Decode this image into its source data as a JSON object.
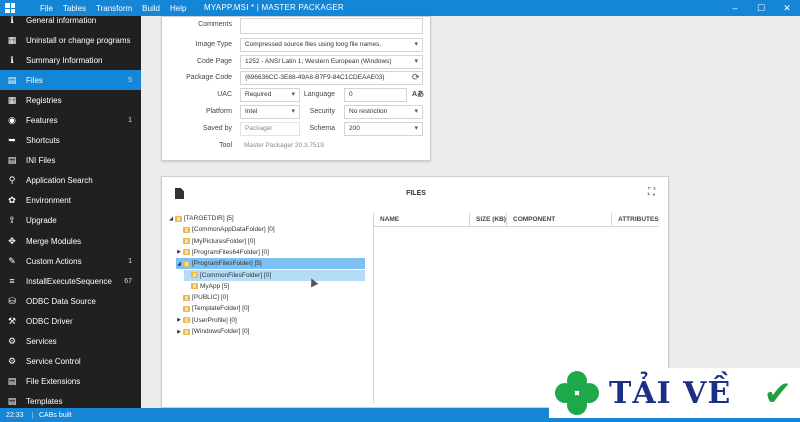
{
  "titlebar": {
    "menu": [
      "File",
      "Tables",
      "Transform",
      "Build",
      "Help"
    ],
    "title": "MYAPP.MSI * | MASTER PACKAGER",
    "controls": [
      "–",
      "☐",
      "✕"
    ]
  },
  "sidebar": {
    "items": [
      {
        "label": "General information",
        "icon": "info-icon",
        "count": ""
      },
      {
        "label": "Uninstall or change programs",
        "icon": "grid-icon",
        "count": ""
      },
      {
        "label": "Summary Information",
        "icon": "info-icon",
        "count": ""
      },
      {
        "label": "Files",
        "icon": "files-icon",
        "count": "5",
        "active": true
      },
      {
        "label": "Registries",
        "icon": "registry-icon",
        "count": ""
      },
      {
        "label": "Features",
        "icon": "features-icon",
        "count": "1"
      },
      {
        "label": "Shortcuts",
        "icon": "shortcut-icon",
        "count": ""
      },
      {
        "label": "INI Files",
        "icon": "ini-icon",
        "count": ""
      },
      {
        "label": "Application Search",
        "icon": "search-icon",
        "count": ""
      },
      {
        "label": "Environment",
        "icon": "environment-icon",
        "count": ""
      },
      {
        "label": "Upgrade",
        "icon": "upgrade-icon",
        "count": ""
      },
      {
        "label": "Merge Modules",
        "icon": "merge-icon",
        "count": ""
      },
      {
        "label": "Custom Actions",
        "icon": "custom-action-icon",
        "count": "1"
      },
      {
        "label": "InstallExecuteSequence",
        "icon": "sequence-icon",
        "count": "67"
      },
      {
        "label": "ODBC Data Source",
        "icon": "database-icon",
        "count": ""
      },
      {
        "label": "ODBC Driver",
        "icon": "driver-icon",
        "count": ""
      },
      {
        "label": "Services",
        "icon": "gear-icon",
        "count": ""
      },
      {
        "label": "Service Control",
        "icon": "service-control-icon",
        "count": ""
      },
      {
        "label": "File Extensions",
        "icon": "extensions-icon",
        "count": ""
      },
      {
        "label": "Templates",
        "icon": "templates-icon",
        "count": ""
      }
    ]
  },
  "summary": {
    "comments_label": "Comments",
    "comments_value": "",
    "image_type_label": "Image Type",
    "image_type_value": "Compressed source files using long file names.",
    "code_page_label": "Code Page",
    "code_page_value": "1252 - ANSI Latin 1; Western European (Windows)",
    "package_code_label": "Package Code",
    "package_code_value": "{696636CC-3E88-49A8-B7F9-84C1CDEAAE03}",
    "uac_label": "UAC",
    "uac_value": "Required",
    "language_label": "Language",
    "language_value": "0",
    "platform_label": "Platform",
    "platform_value": "Intel",
    "security_label": "Security",
    "security_value": "No restriction",
    "saved_by_label": "Saved by",
    "saved_by_value": "Packager",
    "schema_label": "Schema",
    "schema_value": "200",
    "tool_label": "Tool",
    "tool_value": "Master Packager 20.3.7519"
  },
  "files": {
    "title": "FILES",
    "columns": [
      "NAME",
      "SIZE (KB)",
      "COMPONENT",
      "ATTRIBUTES"
    ],
    "tree": [
      {
        "label": "[TARGETDIR] [5]",
        "depth": 0,
        "arrow": "◢"
      },
      {
        "label": "[CommonAppDataFolder] [0]",
        "depth": 1,
        "arrow": ""
      },
      {
        "label": "[MyPicturesFolder] [0]",
        "depth": 1,
        "arrow": ""
      },
      {
        "label": "[ProgramFiles64Folder] [0]",
        "depth": 1,
        "arrow": "▶"
      },
      {
        "label": "[ProgramFilesFolder] [5]",
        "depth": 1,
        "arrow": "◢",
        "sel": 1
      },
      {
        "label": "[CommonFilesFolder] [0]",
        "depth": 2,
        "arrow": "",
        "sel": 2
      },
      {
        "label": "MyApp [5]",
        "depth": 2,
        "arrow": ""
      },
      {
        "label": "[PUBLIC] [0]",
        "depth": 1,
        "arrow": ""
      },
      {
        "label": "[TemplateFolder] [0]",
        "depth": 1,
        "arrow": ""
      },
      {
        "label": "[UserProfile] [0]",
        "depth": 1,
        "arrow": "▶"
      },
      {
        "label": "[WindowsFolder] [0]",
        "depth": 1,
        "arrow": "▶"
      }
    ]
  },
  "statusbar": {
    "time": "22:33",
    "message": "CABs built"
  },
  "watermark": {
    "text": "TẢI VỀ"
  },
  "colors": {
    "accent": "#1585d6",
    "sidebar_bg": "#202020",
    "selection": "#7dc0f2"
  }
}
